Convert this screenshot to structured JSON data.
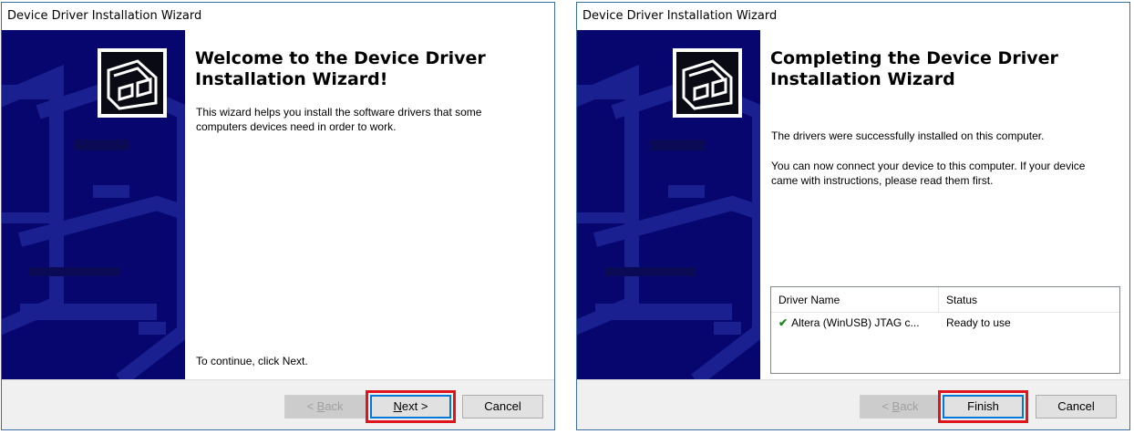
{
  "colors": {
    "banner_bg": "#06066e",
    "banner_shapes": "#1a2090",
    "highlight_box": "#e0141c",
    "default_button_border": "#0078d7",
    "check_green": "#1a8a1a"
  },
  "windows": [
    {
      "title": "Device Driver Installation Wizard",
      "heading_line1": "Welcome to the Device Driver",
      "heading_line2": "Installation Wizard!",
      "description": "This wizard helps you install the software drivers that some computers devices need in order to work.",
      "continue_text": "To continue, click Next.",
      "buttons": {
        "back_prefix": "< ",
        "back_accel": "B",
        "back_rest": "ack",
        "next_accel": "N",
        "next_rest": "ext >",
        "cancel": "Cancel"
      }
    },
    {
      "title": "Device Driver Installation Wizard",
      "heading_line1": "Completing the Device Driver",
      "heading_line2": "Installation Wizard",
      "success_text": "The drivers were successfully installed on this computer.",
      "connect_text": "You can now connect your device to this computer. If your device came with instructions, please read them first.",
      "driver_table": {
        "columns": [
          "Driver Name",
          "Status"
        ],
        "rows": [
          {
            "icon": "check-icon",
            "name": "Altera (WinUSB) JTAG c...",
            "status": "Ready to use"
          }
        ]
      },
      "buttons": {
        "back_prefix": "< ",
        "back_accel": "B",
        "back_rest": "ack",
        "finish": "Finish",
        "cancel": "Cancel"
      }
    }
  ]
}
